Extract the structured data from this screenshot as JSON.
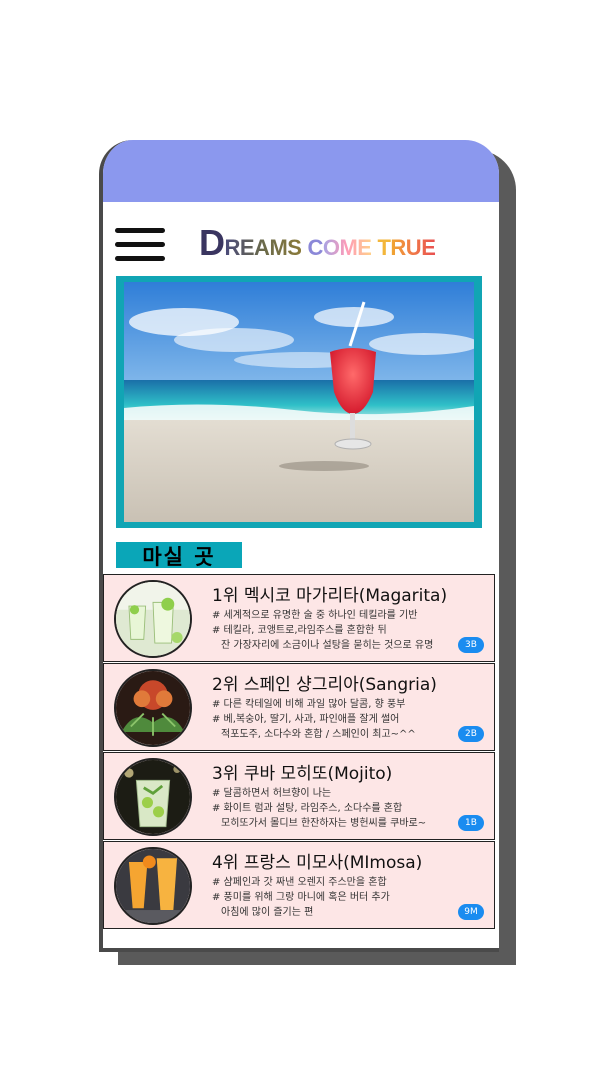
{
  "header": {
    "logo_parts": [
      "D",
      "REAMS",
      "C",
      "OME",
      "T",
      "RUE"
    ]
  },
  "section": {
    "label": "마실 곳"
  },
  "items": [
    {
      "title": "1위 멕시코 마가리타(Magarita)",
      "line1": "# 세계적으로 유명한 술 중 하나인 테킬라를 기반",
      "line2": "# 테킬라, 코앵트로,라임주스를 혼합한 뒤",
      "line3": "잔 가장자리에 소금이나 설탕을 묻히는 것으로 유명",
      "badge": "3B"
    },
    {
      "title": "2위 스페인 샹그리아(Sangria)",
      "line1": "# 다른 칵테일에 비해 과일 많아 달콤, 향 풍부",
      "line2": "# 베,복숭아, 딸기, 사과, 파인애플 잘게 썰어",
      "line3": "적포도주, 소다수와 혼합  / 스페인이 최고~^^",
      "badge": "2B"
    },
    {
      "title": "3위 쿠바 모히또(Mojito)",
      "line1": "# 달콤하면서 허브향이 나는",
      "line2": "# 화이트 럼과 설탕, 라임주스, 소다수를 혼합",
      "line3": "모히또가서 몰디브 한잔하자는 병헌씨를 쿠바로~",
      "badge": "1B"
    },
    {
      "title": "4위 프랑스 미모사(MImosa)",
      "line1": "# 샴페인과 갓 짜낸 오렌지 주스만을 혼합",
      "line2": "# 풍미를 위해 그랑 마니에 혹은 버터 추가",
      "line3": "아침에 많이 즐기는 편",
      "badge": "9M"
    }
  ]
}
